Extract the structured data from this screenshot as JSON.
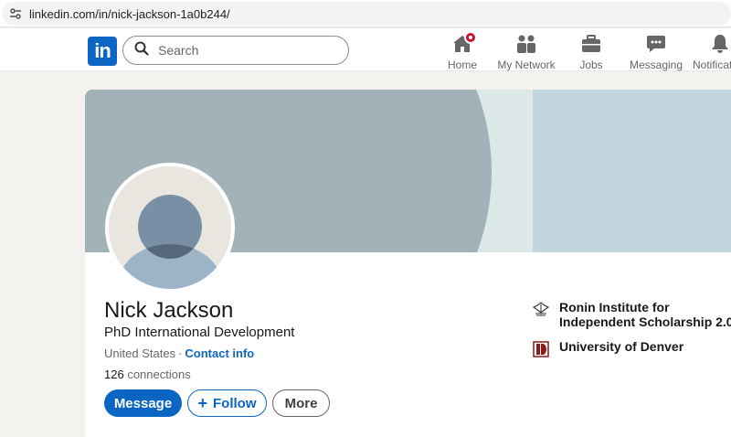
{
  "browser": {
    "url": "linkedin.com/in/nick-jackson-1a0b244/"
  },
  "nav": {
    "logo": "in",
    "search_placeholder": "Search",
    "items": [
      {
        "label": "Home",
        "icon": "home-icon"
      },
      {
        "label": "My Network",
        "icon": "people-icon"
      },
      {
        "label": "Jobs",
        "icon": "briefcase-icon"
      },
      {
        "label": "Messaging",
        "icon": "chat-icon"
      },
      {
        "label": "Notificati",
        "icon": "bell-icon"
      }
    ]
  },
  "profile": {
    "name": "Nick Jackson",
    "headline": "PhD International Development",
    "location": "United States",
    "separator": "·",
    "contact_label": "Contact info",
    "connections_count": "126",
    "connections_label": "connections",
    "buttons": {
      "message": "Message",
      "follow": "Follow",
      "more": "More"
    },
    "education": [
      {
        "name": "Ronin Institute for Independent Scholarship 2.0",
        "line1": "Ronin Institute for",
        "line2": "Independent Scholarship 2.0"
      },
      {
        "name": "University of Denver",
        "line1": "University of Denver",
        "line2": ""
      }
    ]
  },
  "colors": {
    "brand": "#0a66c2",
    "badge": "#cb112d",
    "banner": "#a1b3b8"
  }
}
